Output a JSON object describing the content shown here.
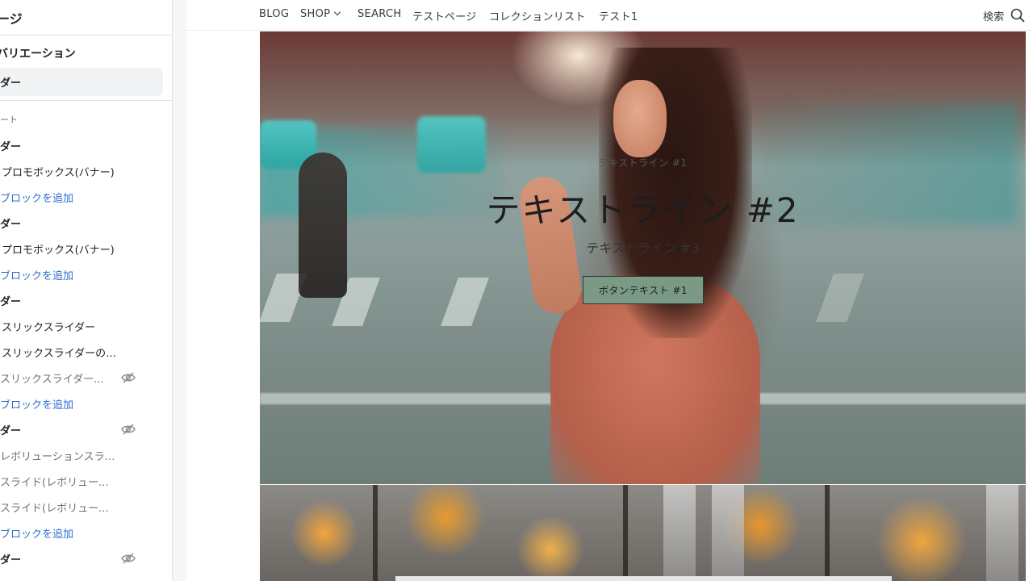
{
  "sidebar": {
    "title": "ージ",
    "section_title": "バリエーション",
    "selected": "ダー",
    "rows": [
      {
        "label": "ート",
        "style": "small"
      },
      {
        "label": "ダー",
        "style": "bold"
      },
      {
        "label": "プロモボックス(バナー)",
        "style": "indent"
      },
      {
        "label": "ブロックを追加",
        "style": "link"
      },
      {
        "label": "ダー",
        "style": "bold"
      },
      {
        "label": "プロモボックス(バナー)",
        "style": "indent"
      },
      {
        "label": "ブロックを追加",
        "style": "link"
      },
      {
        "label": "ダー",
        "style": "bold"
      },
      {
        "label": "スリックスライダー",
        "style": "indent"
      },
      {
        "label": "スリックスライダーのスライド",
        "style": "indent"
      },
      {
        "label": "スリックスライダー...",
        "style": "muted",
        "hidden": true
      },
      {
        "label": "ブロックを追加",
        "style": "link"
      },
      {
        "label": "ダー",
        "style": "bold",
        "hidden": true
      },
      {
        "label": "レボリューションスライダー",
        "style": "muted"
      },
      {
        "label": "スライド(レボリューションス...",
        "style": "muted"
      },
      {
        "label": "スライド(レボリューションス...",
        "style": "muted"
      },
      {
        "label": "ブロックを追加",
        "style": "link"
      },
      {
        "label": "ダー",
        "style": "bold",
        "hidden": true
      }
    ],
    "eye_icon": "eye-slash-icon"
  },
  "nav": {
    "items": [
      "BLOG",
      "SHOP",
      "SEARCH",
      "テストページ",
      "コレクションリスト",
      "テスト1"
    ],
    "search_label": "検索",
    "search_icon": "search-icon"
  },
  "hero": {
    "subheading": "テキストライン #1",
    "heading": "テキストライン #2",
    "line3": "テキストライン #3",
    "button": "ボタンテキスト #1"
  },
  "colors": {
    "link": "#2c6ecb",
    "button_bg": "#7a9a86"
  }
}
